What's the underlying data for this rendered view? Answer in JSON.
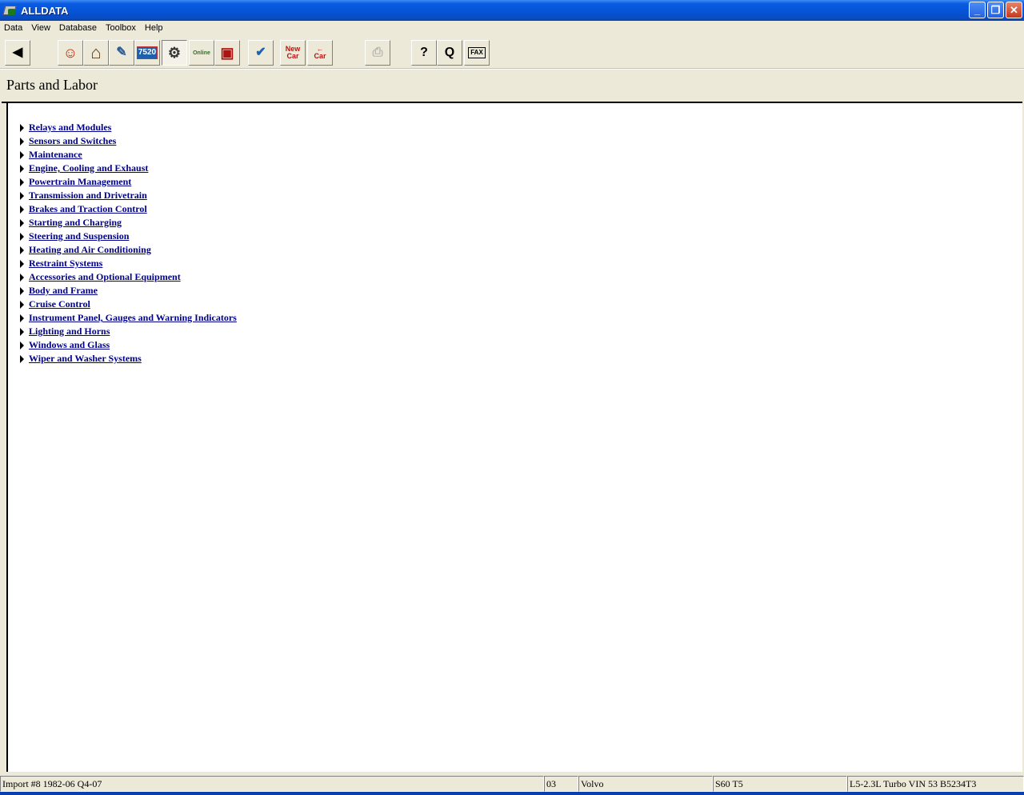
{
  "window": {
    "title": "ALLDATA"
  },
  "menu": [
    "Data",
    "View",
    "Database",
    "Toolbox",
    "Help"
  ],
  "toolbar": {
    "buttons": [
      {
        "name": "back-button",
        "icon": "arrow-left-icon",
        "glyph": "◀"
      },
      {
        "name": "specs-button",
        "icon": "person-icon",
        "glyph": "☺"
      },
      {
        "name": "garage-button",
        "icon": "house-icon",
        "glyph": "⌂"
      },
      {
        "name": "diagnostics-button",
        "icon": "scanner-icon",
        "glyph": "✎"
      },
      {
        "name": "tsb-button",
        "icon": "tsb-counter-icon",
        "glyph": "7520"
      },
      {
        "name": "parts-labor-button",
        "icon": "parts-labor-icon",
        "glyph": "⚙"
      },
      {
        "name": "online-button",
        "icon": "online-icon",
        "glyph": "Online"
      },
      {
        "name": "book-button",
        "icon": "book-icon",
        "glyph": "▣"
      },
      {
        "name": "estimate-button",
        "icon": "clipboard-icon",
        "glyph": "✔"
      },
      {
        "name": "new-car-button",
        "icon": "new-car-icon",
        "glyph": "New Car"
      },
      {
        "name": "previous-car-button",
        "icon": "previous-car-icon",
        "glyph": "← Car"
      },
      {
        "name": "print-button",
        "icon": "printer-icon",
        "glyph": "⎙"
      },
      {
        "name": "help-button",
        "icon": "question-icon",
        "glyph": "?"
      },
      {
        "name": "search-button",
        "icon": "magnifier-icon",
        "glyph": "Q"
      },
      {
        "name": "fax-button",
        "icon": "fax-icon",
        "glyph": "FAX"
      }
    ]
  },
  "page": {
    "title": "Parts and Labor",
    "links": [
      "Relays and Modules",
      "Sensors and Switches",
      "Maintenance",
      "Engine, Cooling and Exhaust",
      "Powertrain Management",
      "Transmission and Drivetrain",
      "Brakes and Traction Control",
      "Starting and Charging",
      "Steering and Suspension",
      "Heating and Air Conditioning",
      "Restraint Systems",
      "Accessories and Optional Equipment",
      "Body and Frame",
      "Cruise Control",
      "Instrument Panel, Gauges and Warning Indicators",
      "Lighting and Horns",
      "Windows and Glass",
      "Wiper and Washer Systems"
    ]
  },
  "status": {
    "database": "Import #8 1982-06 Q4-07",
    "year": "03",
    "make": "Volvo",
    "model": "S60 T5",
    "engine": "L5-2.3L Turbo VIN 53 B5234T3"
  },
  "colors": {
    "link": "#00008b",
    "titlebar": "#0553d6",
    "chrome": "#ece9d8"
  }
}
